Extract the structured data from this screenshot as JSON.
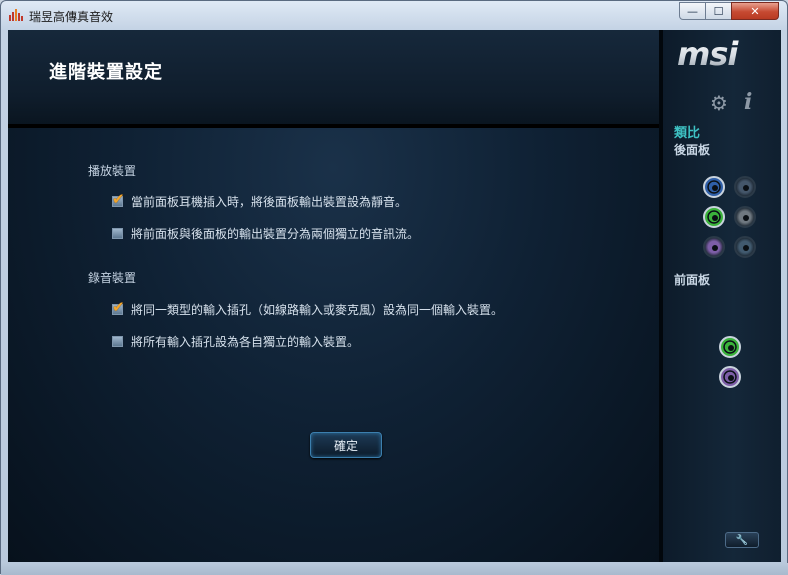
{
  "window": {
    "title": "瑞昱高傳真音效",
    "min_glyph": "—",
    "max_glyph": "☐",
    "close_glyph": "✕"
  },
  "header": {
    "title": "進階裝置設定"
  },
  "playback": {
    "section_label": "播放裝置",
    "options": [
      {
        "label": "當前面板耳機插入時，將後面板輸出裝置設為靜音。",
        "checked": true
      },
      {
        "label": "將前面板與後面板的輸出裝置分為兩個獨立的音訊流。",
        "checked": false
      }
    ]
  },
  "recording": {
    "section_label": "錄音裝置",
    "options": [
      {
        "label": "將同一類型的輸入插孔（如線路輸入或麥克風）設為同一個輸入裝置。",
        "checked": true
      },
      {
        "label": "將所有輸入插孔設為各自獨立的輸入裝置。",
        "checked": false
      }
    ]
  },
  "ok_button": {
    "label": "確定"
  },
  "sidebar": {
    "logo": "msi",
    "mode_label": "類比",
    "back_panel_label": "後面板",
    "front_panel_label": "前面板",
    "back_jacks": [
      {
        "color": "#2f5fa8",
        "active": true
      },
      {
        "color": "#44566a",
        "active": false
      },
      {
        "color": "#3bb33b",
        "active": true
      },
      {
        "color": "#6f7880",
        "active": false
      },
      {
        "color": "#7d5ea7",
        "active": false
      },
      {
        "color": "#415a6f",
        "active": false
      }
    ],
    "front_jacks": [
      {
        "color": "#3bb33b",
        "active": true
      },
      {
        "color": "#7d5ea7",
        "active": true
      }
    ],
    "icons": [
      "gear-icon",
      "info-icon",
      "wrench-icon"
    ]
  }
}
